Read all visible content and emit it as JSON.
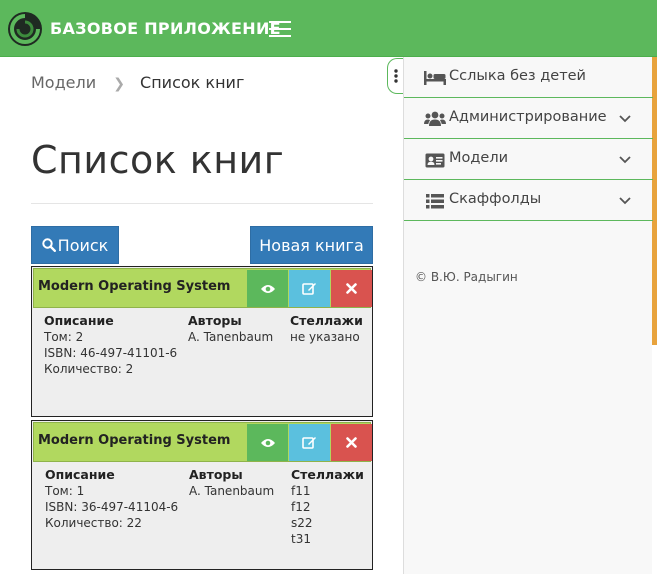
{
  "app": {
    "brand": "БАЗОВОЕ ПРИЛОЖЕНИЕ"
  },
  "breadcrumb": {
    "parent": "Модели",
    "current": "Список книг"
  },
  "page": {
    "title": "Список книг",
    "search_label": "Поиск",
    "new_label": "Новая книга"
  },
  "columns": {
    "description": "Описание",
    "authors": "Авторы",
    "shelves": "Стеллажи"
  },
  "books": [
    {
      "title": "Modern Operating System",
      "volume": "Том: 2",
      "isbn": "ISBN: 46-497-41101-6",
      "quantity": "Количество: 2",
      "author": "A. Tanenbaum",
      "shelves": [
        "не указано"
      ]
    },
    {
      "title": "Modern Operating System",
      "volume": "Том: 1",
      "isbn": "ISBN: 36-497-41104-6",
      "quantity": "Количество: 22",
      "author": "A. Tanenbaum",
      "shelves": [
        "f11",
        "f12",
        "s22",
        "t31"
      ]
    }
  ],
  "sidebar": {
    "items": [
      {
        "label": "Сслыка без детей",
        "icon": "bed-icon"
      },
      {
        "label": "Администрирование",
        "icon": "users-icon"
      },
      {
        "label": "Модели",
        "icon": "id-card-icon"
      },
      {
        "label": "Скаффолды",
        "icon": "list-icon"
      }
    ],
    "footer": "© В.Ю. Радыгин"
  },
  "colors": {
    "brand_green": "#5cb85c",
    "primary_blue": "#337ab7",
    "card_header": "#b1d85f",
    "info": "#5bc0de",
    "danger": "#d9534f"
  }
}
